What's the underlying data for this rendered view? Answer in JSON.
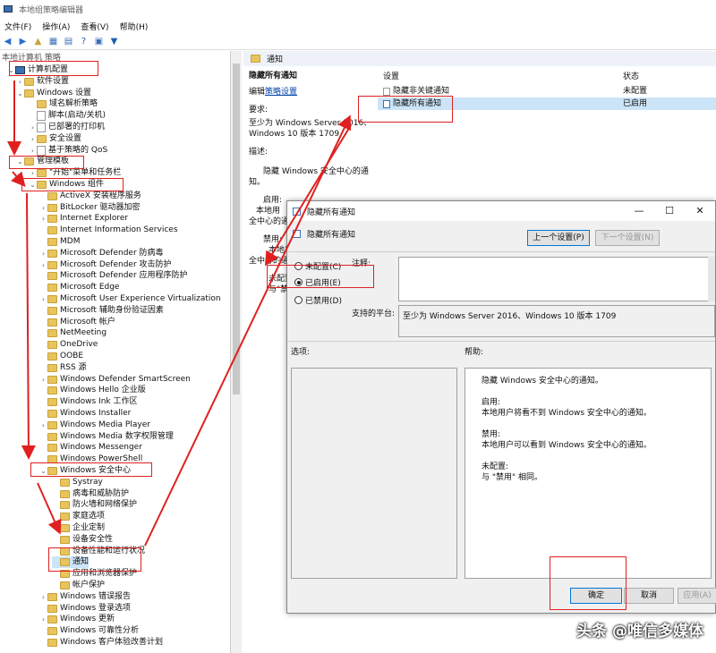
{
  "window": {
    "title": "本地组策略编辑器"
  },
  "menu": [
    "文件(F)",
    "操作(A)",
    "查看(V)",
    "帮助(H)"
  ],
  "tree": {
    "root": "本地计算机 策略",
    "items": [
      {
        "label": "计算机配置",
        "level": 1,
        "arrow": "v",
        "icon": "comp"
      },
      {
        "label": "软件设置",
        "level": 2,
        "arrow": ">",
        "icon": "fold"
      },
      {
        "label": "Windows 设置",
        "level": 2,
        "arrow": "v",
        "icon": "fold"
      },
      {
        "label": "域名解析策略",
        "level": 3,
        "arrow": "",
        "icon": "fold"
      },
      {
        "label": "脚本(启动/关机)",
        "level": 3,
        "arrow": "",
        "icon": "doc"
      },
      {
        "label": "已部署的打印机",
        "level": 3,
        "arrow": ">",
        "icon": "doc"
      },
      {
        "label": "安全设置",
        "level": 3,
        "arrow": ">",
        "icon": "fold"
      },
      {
        "label": "基于策略的 QoS",
        "level": 3,
        "arrow": ">",
        "icon": "doc"
      },
      {
        "label": "管理模板",
        "level": 2,
        "arrow": "v",
        "icon": "fold"
      },
      {
        "label": "\"开始\"菜单和任务栏",
        "level": 3,
        "arrow": ">",
        "icon": "fold"
      },
      {
        "label": "Windows 组件",
        "level": 3,
        "arrow": "v",
        "icon": "fold"
      },
      {
        "label": "ActiveX 安装程序服务",
        "level": 4,
        "arrow": "",
        "icon": "fold"
      },
      {
        "label": "BitLocker 驱动器加密",
        "level": 4,
        "arrow": ">",
        "icon": "fold"
      },
      {
        "label": "Internet Explorer",
        "level": 4,
        "arrow": ">",
        "icon": "fold"
      },
      {
        "label": "Internet Information Services",
        "level": 4,
        "arrow": "",
        "icon": "fold"
      },
      {
        "label": "MDM",
        "level": 4,
        "arrow": "",
        "icon": "fold"
      },
      {
        "label": "Microsoft Defender 防病毒",
        "level": 4,
        "arrow": ">",
        "icon": "fold"
      },
      {
        "label": "Microsoft Defender 攻击防护",
        "level": 4,
        "arrow": ">",
        "icon": "fold"
      },
      {
        "label": "Microsoft Defender 应用程序防护",
        "level": 4,
        "arrow": "",
        "icon": "fold"
      },
      {
        "label": "Microsoft Edge",
        "level": 4,
        "arrow": "",
        "icon": "fold"
      },
      {
        "label": "Microsoft User Experience Virtualization",
        "level": 4,
        "arrow": ">",
        "icon": "fold"
      },
      {
        "label": "Microsoft 辅助身份验证因素",
        "level": 4,
        "arrow": "",
        "icon": "fold"
      },
      {
        "label": "Microsoft 帐户",
        "level": 4,
        "arrow": "",
        "icon": "fold"
      },
      {
        "label": "NetMeeting",
        "level": 4,
        "arrow": "",
        "icon": "fold"
      },
      {
        "label": "OneDrive",
        "level": 4,
        "arrow": "",
        "icon": "fold"
      },
      {
        "label": "OOBE",
        "level": 4,
        "arrow": "",
        "icon": "fold"
      },
      {
        "label": "RSS 源",
        "level": 4,
        "arrow": "",
        "icon": "fold"
      },
      {
        "label": "Windows Defender SmartScreen",
        "level": 4,
        "arrow": ">",
        "icon": "fold"
      },
      {
        "label": "Windows Hello 企业版",
        "level": 4,
        "arrow": "",
        "icon": "fold"
      },
      {
        "label": "Windows Ink 工作区",
        "level": 4,
        "arrow": "",
        "icon": "fold"
      },
      {
        "label": "Windows Installer",
        "level": 4,
        "arrow": "",
        "icon": "fold"
      },
      {
        "label": "Windows Media Player",
        "level": 4,
        "arrow": ">",
        "icon": "fold"
      },
      {
        "label": "Windows Media 数字权限管理",
        "level": 4,
        "arrow": "",
        "icon": "fold"
      },
      {
        "label": "Windows Messenger",
        "level": 4,
        "arrow": "",
        "icon": "fold"
      },
      {
        "label": "Windows PowerShell",
        "level": 4,
        "arrow": "",
        "icon": "fold"
      },
      {
        "label": "Windows 安全中心",
        "level": 4,
        "arrow": "v",
        "icon": "fold"
      },
      {
        "label": "Systray",
        "level": 5,
        "arrow": "",
        "icon": "fold"
      },
      {
        "label": "病毒和威胁防护",
        "level": 5,
        "arrow": "",
        "icon": "fold"
      },
      {
        "label": "防火墙和网络保护",
        "level": 5,
        "arrow": "",
        "icon": "fold"
      },
      {
        "label": "家庭选项",
        "level": 5,
        "arrow": "",
        "icon": "fold"
      },
      {
        "label": "企业定制",
        "level": 5,
        "arrow": "",
        "icon": "fold"
      },
      {
        "label": "设备安全性",
        "level": 5,
        "arrow": "",
        "icon": "fold"
      },
      {
        "label": "设备性能和运行状况",
        "level": 5,
        "arrow": "",
        "icon": "fold"
      },
      {
        "label": "通知",
        "level": 5,
        "arrow": "",
        "icon": "fold"
      },
      {
        "label": "应用和浏览器保护",
        "level": 5,
        "arrow": "",
        "icon": "fold"
      },
      {
        "label": "帐户保护",
        "level": 5,
        "arrow": "",
        "icon": "fold"
      },
      {
        "label": "Windows 错误报告",
        "level": 4,
        "arrow": ">",
        "icon": "fold"
      },
      {
        "label": "Windows 登录选项",
        "level": 4,
        "arrow": "",
        "icon": "fold"
      },
      {
        "label": "Windows 更新",
        "level": 4,
        "arrow": ">",
        "icon": "fold"
      },
      {
        "label": "Windows 可靠性分析",
        "level": 4,
        "arrow": "",
        "icon": "fold"
      },
      {
        "label": "Windows 客户体验改善计划",
        "level": 4,
        "arrow": "",
        "icon": "fold"
      }
    ]
  },
  "right": {
    "header": "通知",
    "policy_title": "隐藏所有通知",
    "edit_prefix": "编辑",
    "edit_link": "策略设置",
    "req_label": "要求:",
    "req_text1": "至少为 Windows Server 2016、",
    "req_text2": "Windows 10 版本 1709",
    "desc_label": "描述:",
    "desc_lines": [
      "隐藏 Windows 安全中心的通",
      "知。",
      "启用:",
      "本地用",
      "全中心的通",
      "禁用:",
      "本地用",
      "全中心的通",
      "未配置",
      "与\"禁用"
    ],
    "col_setting": "设置",
    "col_state": "状态",
    "rows": [
      {
        "name": "隐藏非关键通知",
        "state": "未配置"
      },
      {
        "name": "隐藏所有通知",
        "state": "已启用"
      }
    ]
  },
  "dialog": {
    "title": "隐藏所有通知",
    "subtitle": "隐藏所有通知",
    "prev": "上一个设置(P)",
    "next": "下一个设置(N)",
    "r_notconf": "未配置(C)",
    "r_enabled": "已启用(E)",
    "r_disabled": "已禁用(D)",
    "note_label": "注释:",
    "platform_label": "支持的平台:",
    "platform_value": "至少为 Windows Server 2016、Windows 10 版本 1709",
    "options_label": "选项:",
    "help_label": "帮助:",
    "help_lines": [
      "隐藏 Windows 安全中心的通知。",
      "",
      "启用:",
      "本地用户将看不到 Windows 安全中心的通知。",
      "",
      "禁用:",
      "本地用户可以看到 Windows 安全中心的通知。",
      "",
      "未配置:",
      "与 \"禁用\" 相同。"
    ],
    "ok": "确定",
    "cancel": "取消",
    "apply": "应用(A)"
  },
  "watermark": "头条 @唯信多媒体"
}
